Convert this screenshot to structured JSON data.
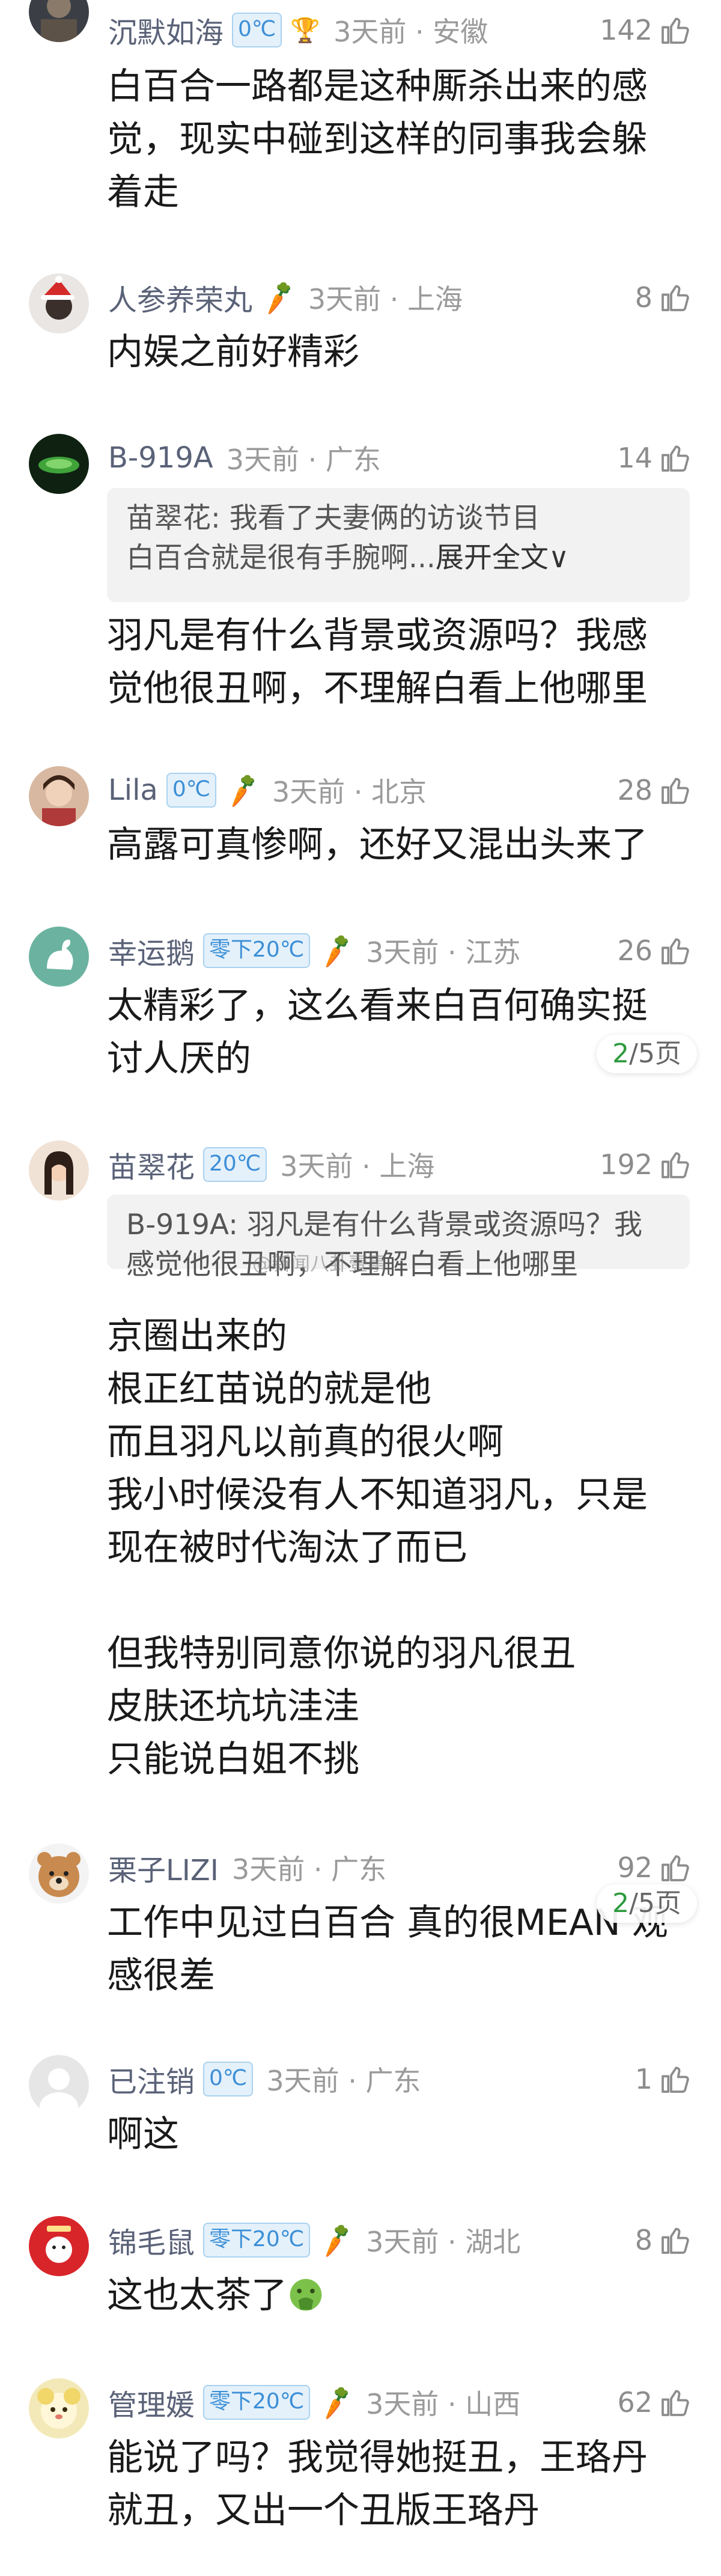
{
  "colors": {
    "username": "#5a6278",
    "badge_text": "#3d8fd6",
    "badge_bg": "#e4f1fb",
    "meta": "#9a9a9a",
    "pager_current": "#2e9b3e"
  },
  "comments": [
    {
      "username": "沉默如海",
      "badge": "0℃",
      "time_location": "3天前 · 安徽",
      "likes": "142",
      "lines": [
        "白百合一路都是这种厮杀出来的感",
        "觉，现实中碰到这样的同事我会躲",
        "着走"
      ]
    },
    {
      "username": "人参养荣丸",
      "time_location": "3天前 · 上海",
      "likes": "8",
      "lines": [
        "内娱之前好精彩"
      ]
    },
    {
      "username": "B-919A",
      "time_location": "3天前 · 广东",
      "likes": "14",
      "quote": {
        "line1": "苗翠花: 我看了夫妻俩的访谈节目",
        "line2": "白百合就是很有手腕啊...",
        "expand": "展开全文∨"
      },
      "lines": [
        "羽凡是有什么背景或资源吗？我感",
        "觉他很丑啊，不理解白看上他哪里"
      ]
    },
    {
      "username": "Lila",
      "badge": "0℃",
      "time_location": "3天前 · 北京",
      "likes": "28",
      "lines": [
        "高露可真惨啊，还好又混出头来了"
      ]
    },
    {
      "username": "幸运鹅",
      "badge": "零下20℃",
      "time_location": "3天前 · 江苏",
      "likes": "26",
      "lines": [
        "太精彩了，这么看来白百何确实挺",
        "讨人厌的"
      ]
    },
    {
      "username": "苗翠花",
      "badge": "20℃",
      "time_location": "3天前 · 上海",
      "likes": "192",
      "quote": {
        "line1": "B-919A: 羽凡是有什么背景或资源吗？我",
        "line2": "感觉他很丑啊，不理解白看上他哪里"
      },
      "lines": [
        "京圈出来的",
        "根正红苗说的就是他",
        "而且羽凡以前真的很火啊",
        "我小时候没有人不知道羽凡，只是",
        "现在被时代淘汰了而已",
        "",
        "但我特别同意你说的羽凡很丑",
        "皮肤还坑坑洼洼",
        "只能说白姐不挑"
      ]
    },
    {
      "username": "栗子LIZI",
      "time_location": "3天前 · 广东",
      "likes": "92",
      "lines": [
        "工作中见过白百合 真的很MEAN 观",
        "感很差"
      ]
    },
    {
      "username": "已注销",
      "badge": "0℃",
      "time_location": "3天前 · 广东",
      "likes": "1",
      "lines": [
        "啊这"
      ]
    },
    {
      "username": "锦毛鼠",
      "badge": "零下20℃",
      "time_location": "3天前 · 湖北",
      "likes": "8",
      "lines": [
        "这也太茶了"
      ]
    },
    {
      "username": "管理媛",
      "badge": "零下20℃",
      "time_location": "3天前 · 山西",
      "likes": "62",
      "lines": [
        "能说了吗？我觉得她挺丑，王珞丹",
        "就丑，又出一个丑版王珞丹"
      ]
    }
  ],
  "pager": {
    "current": "2",
    "rest": "/5页"
  },
  "watermark": "@新闻八卦壹事"
}
